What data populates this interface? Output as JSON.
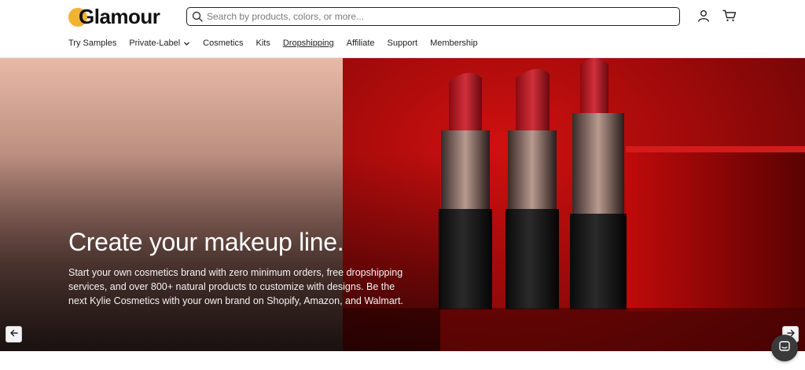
{
  "header": {
    "logo_text": "Glamour",
    "search_placeholder": "Search by products, colors, or more...",
    "icons": {
      "account": "user-icon",
      "cart": "cart-icon",
      "search": "search-icon"
    }
  },
  "nav": {
    "items": [
      {
        "label": "Try Samples"
      },
      {
        "label": "Private-Label"
      },
      {
        "label": "Cosmetics"
      },
      {
        "label": "Kits"
      },
      {
        "label": "Dropshipping"
      },
      {
        "label": "Affiliate"
      },
      {
        "label": "Support"
      },
      {
        "label": "Membership"
      }
    ]
  },
  "hero": {
    "title": "Create your makeup line.",
    "description": "Start your own cosmetics brand with zero minimum orders, free dropshipping services, and over 800+ natural products to customize with designs. Be the next Kylie Cosmetics with your own brand on Shopify, Amazon, and Walmart.",
    "prev_icon": "arrow-left-icon",
    "next_icon": "arrow-right-icon"
  },
  "chat": {
    "icon": "chat-icon"
  },
  "colors": {
    "logo_accent": "#f2b234",
    "hero_red": "#b00a0a",
    "text_dark": "#1a1a1a"
  }
}
